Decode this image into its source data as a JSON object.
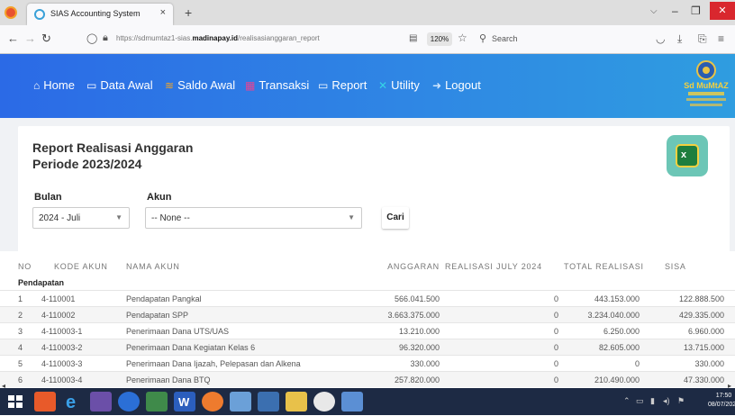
{
  "browser": {
    "tab_title": "SIAS Accounting System",
    "tab_close": "×",
    "new_tab": "+",
    "url_prefix": "https://sdmumtaz1-sias.",
    "url_domain": "madinapay.id",
    "url_path": "/realisasianggaran_report",
    "zoom": "120%",
    "search_placeholder": "Search"
  },
  "menu": {
    "items": [
      {
        "label": "Home",
        "icon": "home-icon"
      },
      {
        "label": "Data Awal",
        "icon": "monitor-icon"
      },
      {
        "label": "Saldo Awal",
        "icon": "stack-icon"
      },
      {
        "label": "Transaksi",
        "icon": "grid-icon"
      },
      {
        "label": "Report",
        "icon": "monitor-icon"
      },
      {
        "label": "Utility",
        "icon": "tools-icon"
      },
      {
        "label": "Logout",
        "icon": "arrow-icon"
      }
    ],
    "logo_text": "Sd MuMtAZ"
  },
  "report": {
    "title": "Report Realisasi Anggaran",
    "subtitle": "Periode 2023/2024",
    "export_icon": "excel-icon",
    "filters": {
      "bulan_label": "Bulan",
      "bulan_value": "2024 - Juli",
      "akun_label": "Akun",
      "akun_value": "-- None --",
      "search_button": "Cari"
    }
  },
  "table": {
    "headers": [
      "NO",
      "KODE AKUN",
      "NAMA AKUN",
      "ANGGARAN",
      "REALISASI JULY 2024",
      "TOTAL REALISASI",
      "SISA"
    ],
    "group": "Pendapatan",
    "rows": [
      {
        "no": "1",
        "kode": "4-110001",
        "nama": "Pendapatan Pangkal",
        "anggaran": "566.041.500",
        "realisasi": "0",
        "total": "443.153.000",
        "sisa": "122.888.500"
      },
      {
        "no": "2",
        "kode": "4-110002",
        "nama": "Pendapatan SPP",
        "anggaran": "3.663.375.000",
        "realisasi": "0",
        "total": "3.234.040.000",
        "sisa": "429.335.000"
      },
      {
        "no": "3",
        "kode": "4-110003-1",
        "nama": "Penerimaan Dana UTS/UAS",
        "anggaran": "13.210.000",
        "realisasi": "0",
        "total": "6.250.000",
        "sisa": "6.960.000"
      },
      {
        "no": "4",
        "kode": "4-110003-2",
        "nama": "Penerimaan Dana Kegiatan Kelas 6",
        "anggaran": "96.320.000",
        "realisasi": "0",
        "total": "82.605.000",
        "sisa": "13.715.000"
      },
      {
        "no": "5",
        "kode": "4-110003-3",
        "nama": "Penerimaan Dana Ijazah, Pelepasan dan Alkena",
        "anggaran": "330.000",
        "realisasi": "0",
        "total": "0",
        "sisa": "330.000"
      },
      {
        "no": "6",
        "kode": "4-110003-4",
        "nama": "Penerimaan Dana BTQ",
        "anggaran": "257.820.000",
        "realisasi": "0",
        "total": "210.490.000",
        "sisa": "47.330.000"
      }
    ]
  },
  "taskbar": {
    "time": "17:50",
    "date": "08/07/2024"
  }
}
